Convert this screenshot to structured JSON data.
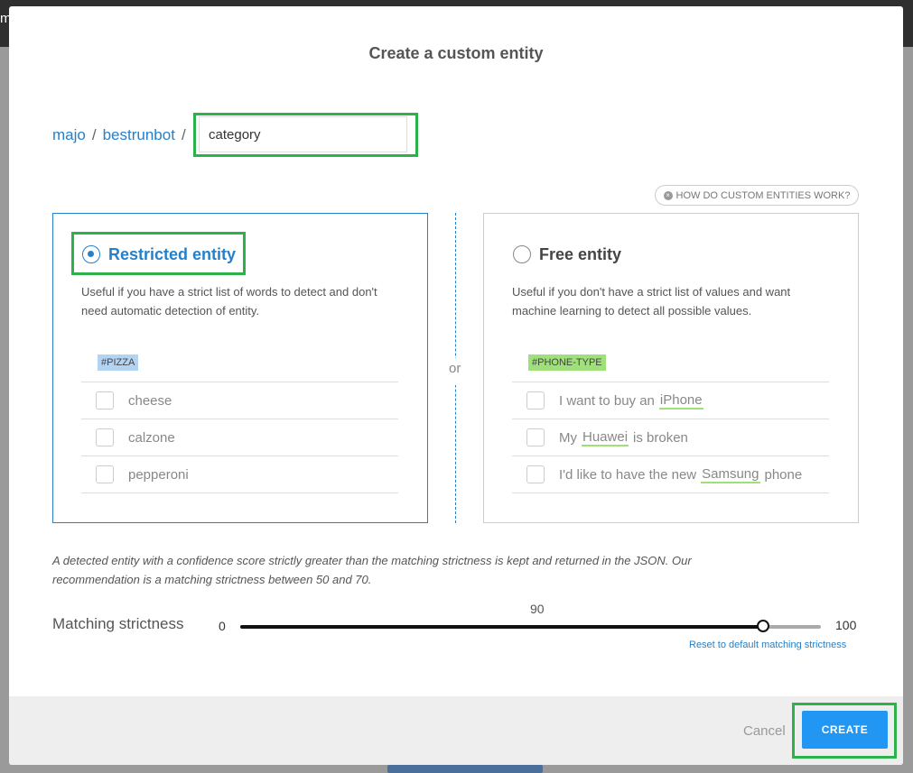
{
  "background": {
    "topbar_letter": "m"
  },
  "modal": {
    "title": "Create a custom entity",
    "breadcrumb": {
      "user": "majo",
      "bot": "bestrunbot",
      "separator": "/"
    },
    "entity_name_input": {
      "value": "category"
    },
    "help_button": {
      "label": "HOW DO CUSTOM ENTITIES WORK?",
      "icon": "close-circle-icon"
    },
    "or_label": "or",
    "restricted": {
      "title": "Restricted entity",
      "selected": true,
      "description": "Useful if you have a strict list of words to detect and don't need automatic detection of entity.",
      "tag": "#PIZZA",
      "examples": [
        "cheese",
        "calzone",
        "pepperoni"
      ]
    },
    "free": {
      "title": "Free entity",
      "selected": false,
      "description": "Useful if you don't have a strict list of values and want machine learning to detect all possible values.",
      "tag": "#PHONE-TYPE",
      "examples": [
        {
          "before": "I want to buy an",
          "highlight": "iPhone",
          "after": ""
        },
        {
          "before": "My",
          "highlight": "Huawei",
          "after": "is broken"
        },
        {
          "before": "I'd like to have the new",
          "highlight": "Samsung",
          "after": "phone"
        }
      ]
    },
    "note": "A detected entity with a confidence score strictly greater than the matching strictness is kept and returned in the JSON. Our recommendation is a matching strictness between 50 and 70.",
    "strictness": {
      "label": "Matching strictness",
      "min": "0",
      "max": "100",
      "value": "90",
      "level": 90,
      "reset_label": "Reset to default matching strictness"
    },
    "footer": {
      "cancel_label": "Cancel",
      "create_label": "CREATE"
    }
  },
  "colors": {
    "accent": "#2680c9",
    "highlight_frame": "#2db14a",
    "button": "#2196f3",
    "tag_blue": "#b3d3f2",
    "tag_green": "#9fe07a"
  }
}
